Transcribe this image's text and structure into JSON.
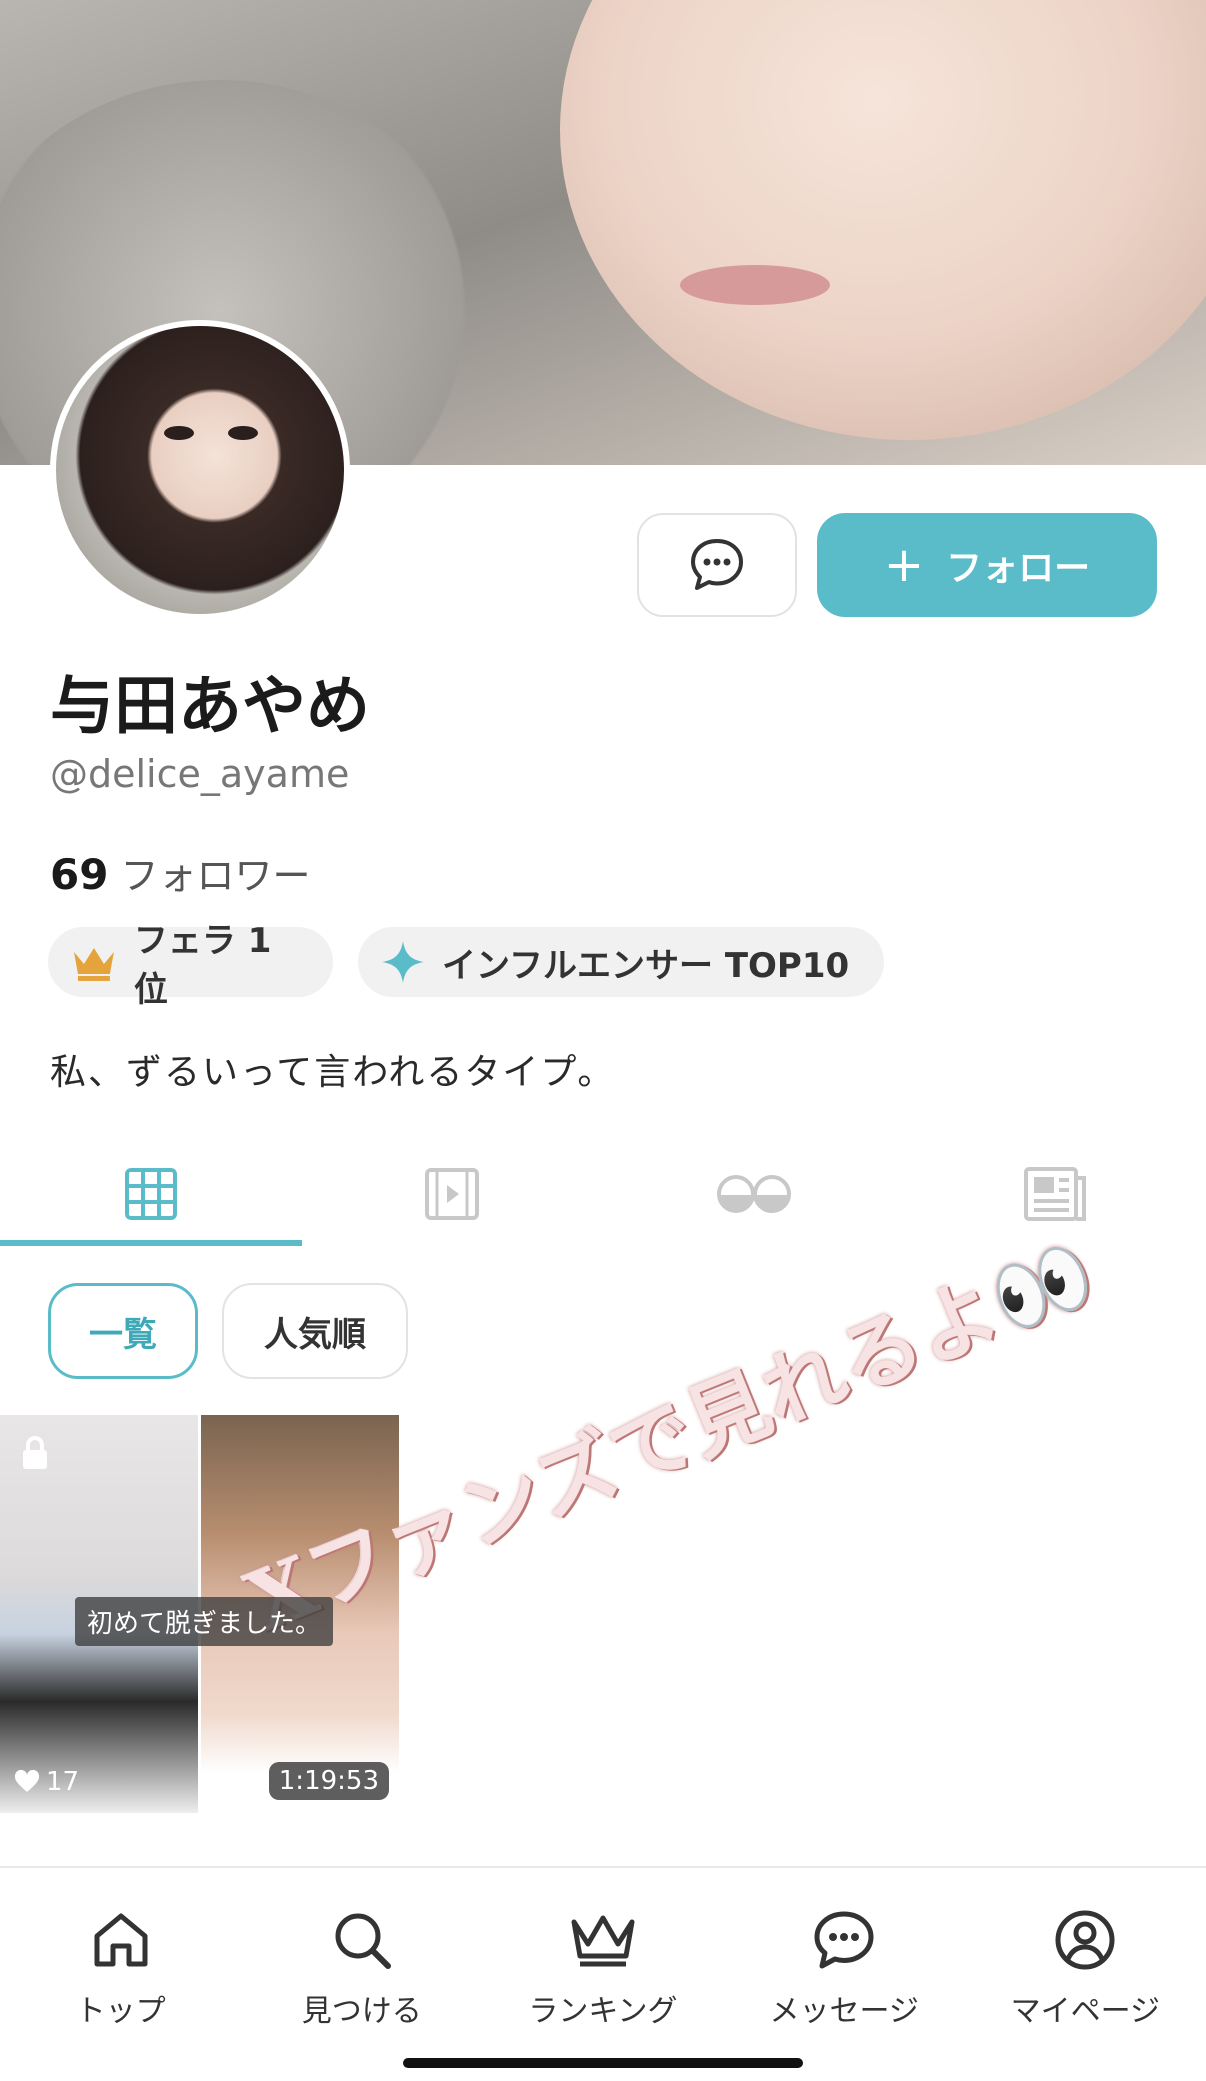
{
  "profile": {
    "name": "与田あやめ",
    "handle": "@delice_ayame",
    "followers_count": "69",
    "followers_label": "フォロワー",
    "bio": "私、ずるいって言われるタイプ。"
  },
  "actions": {
    "message_icon": "chat-bubble-icon",
    "follow_label": "フォロー",
    "follow_plus": "+"
  },
  "badges": [
    {
      "icon": "crown-icon",
      "label": "フェラ 1位"
    },
    {
      "icon": "sparkle-icon",
      "label": "インフルエンサー TOP10"
    }
  ],
  "tabs": [
    {
      "icon": "grid-icon",
      "active": true
    },
    {
      "icon": "video-icon",
      "active": false
    },
    {
      "icon": "eyes-icon",
      "active": false
    },
    {
      "icon": "article-icon",
      "active": false
    }
  ],
  "filters": {
    "all": "一覧",
    "popular": "人気順"
  },
  "posts": [
    {
      "caption": "初めて脱ぎました。",
      "likes": "17",
      "locked": true
    },
    {
      "duration": "1:19:53"
    }
  ],
  "promo_text": "Xファンズで見れるよ👀",
  "bottom_nav": [
    {
      "icon": "home-icon",
      "label": "トップ"
    },
    {
      "icon": "search-icon",
      "label": "見つける"
    },
    {
      "icon": "crown-icon",
      "label": "ランキング"
    },
    {
      "icon": "message-icon",
      "label": "メッセージ"
    },
    {
      "icon": "user-icon",
      "label": "マイページ"
    }
  ],
  "colors": {
    "accent": "#5bbcc9",
    "badge_bg": "#f1f1f1",
    "crown": "#e4a43b"
  }
}
